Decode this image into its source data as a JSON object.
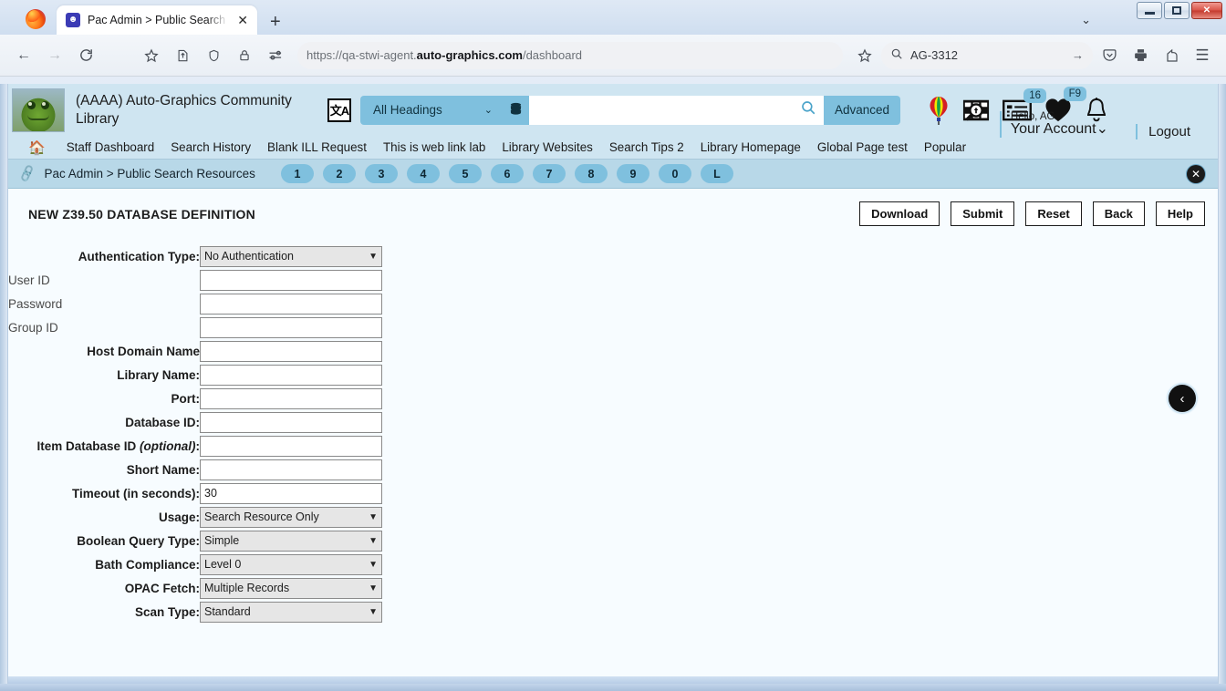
{
  "browser": {
    "tab": {
      "title": "Pac Admin > Public Search Res",
      "favicon": "pac-admin-favicon",
      "close_label": "✕"
    },
    "newtab_label": "+",
    "tabstrip_chevron": "⌄",
    "window_controls": {
      "minimize": "minimize",
      "maximize": "maximize",
      "close": "✕"
    },
    "toolbar": {
      "back": "←",
      "forward": "→",
      "reload": "⟳",
      "bookmark_star": "☆",
      "save_to_pocket": "⤒",
      "shield": "⬠",
      "lock": "🔒",
      "permissions": "⚷",
      "url_prefix": "https://qa-stwi-agent.",
      "url_domain": "auto-graphics.com",
      "url_path": "/dashboard",
      "star": "☆",
      "search_icon": "search-icon",
      "search_value": "AG-3312",
      "search_go": "→",
      "pocket": "⬠",
      "print": "⎙",
      "share": "↱",
      "menu": "☰"
    }
  },
  "app": {
    "library_name": "(AAAA) Auto-Graphics Community Library",
    "catalog_icon_label": "文A",
    "search": {
      "scope_label": "All Headings",
      "scope_chevron": "⌄",
      "db_icon": "database-icon",
      "query_value": "",
      "query_placeholder": "",
      "magnifier": "search-icon",
      "advanced_label": "Advanced"
    },
    "header_icons": [
      {
        "name": "balloon-icon",
        "badge": null
      },
      {
        "name": "research-magnifier-icon",
        "badge": null
      },
      {
        "name": "my-list-icon",
        "badge": "16"
      },
      {
        "name": "favorites-heart-icon",
        "badge": "F9"
      },
      {
        "name": "notification-bell-icon",
        "badge": null
      }
    ],
    "account": {
      "hello": "Hello, AG",
      "label": "Your Account",
      "chevron": "⌄"
    },
    "logout_label": "Logout",
    "nav_items": [
      "Staff Dashboard",
      "Search History",
      "Blank ILL Request",
      "This is web link lab",
      "Library Websites",
      "Search Tips 2",
      "Library Homepage",
      "Global Page test",
      "Popular"
    ],
    "breadcrumb": {
      "chain_icon": "link-icon",
      "text": "Pac Admin > Public Search Resources",
      "pills": [
        "1",
        "2",
        "3",
        "4",
        "5",
        "6",
        "7",
        "8",
        "9",
        "0",
        "L"
      ],
      "close_label": "✕"
    }
  },
  "page": {
    "title": "NEW Z39.50 DATABASE DEFINITION",
    "actions": [
      {
        "label": "Download",
        "name": "download-button"
      },
      {
        "label": "Submit",
        "name": "submit-button"
      },
      {
        "label": "Reset",
        "name": "reset-button"
      },
      {
        "label": "Back",
        "name": "back-button"
      },
      {
        "label": "Help",
        "name": "help-button"
      }
    ],
    "back_circle": "‹",
    "fields": {
      "auth_type": {
        "label": "Authentication Type:",
        "value": "No Authentication"
      },
      "user_id": {
        "label": "User ID",
        "value": ""
      },
      "password": {
        "label": "Password",
        "value": ""
      },
      "group_id": {
        "label": "Group ID",
        "value": ""
      },
      "host_domain": {
        "label": "Host Domain Name",
        "value": ""
      },
      "library_name": {
        "label": "Library Name:",
        "value": ""
      },
      "port": {
        "label": "Port:",
        "value": ""
      },
      "database_id": {
        "label": "Database ID:",
        "value": ""
      },
      "item_database_id": {
        "label": "Item Database ID ",
        "label_italic": "(optional)",
        "label_suffix": ":",
        "value": ""
      },
      "short_name": {
        "label": "Short Name:",
        "value": ""
      },
      "timeout": {
        "label": "Timeout (in seconds):",
        "value": "30"
      },
      "usage": {
        "label": "Usage:",
        "value": "Search Resource Only"
      },
      "boolean_query_type": {
        "label": "Boolean Query Type:",
        "value": "Simple"
      },
      "bath_compliance": {
        "label": "Bath Compliance:",
        "value": "Level 0"
      },
      "opac_fetch": {
        "label": "OPAC Fetch:",
        "value": "Multiple Records"
      },
      "scan_type": {
        "label": "Scan Type:",
        "value": "Standard"
      }
    }
  },
  "colors": {
    "header_blue": "#cfe5f1",
    "pill_blue": "#7fc0de",
    "crumb_band": "#b8d8e8",
    "content_bg": "#f7fcff"
  }
}
